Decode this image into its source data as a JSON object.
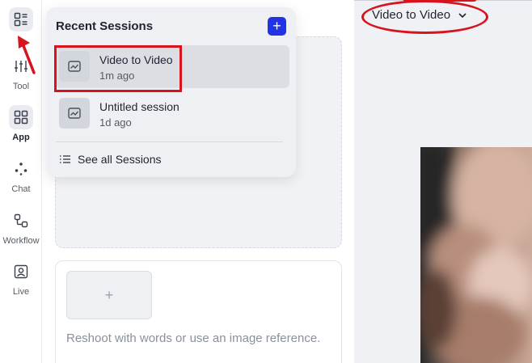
{
  "sidebar": {
    "items": [
      {
        "label": "",
        "icon": "sessions-list-icon"
      },
      {
        "label": "Tool",
        "icon": "sliders-icon"
      },
      {
        "label": "App",
        "icon": "grid-icon"
      },
      {
        "label": "Chat",
        "icon": "dots-icon"
      },
      {
        "label": "Workflow",
        "icon": "workflow-icon"
      },
      {
        "label": "Live",
        "icon": "person-frame-icon"
      }
    ]
  },
  "popover": {
    "title": "Recent Sessions",
    "add_label": "+",
    "sessions": [
      {
        "name": "Video to Video",
        "time": "1m ago",
        "selected": true
      },
      {
        "name": "Untitled session",
        "time": "1d ago",
        "selected": false
      }
    ],
    "see_all_label": "See all Sessions"
  },
  "main": {
    "add_reference_label": "+",
    "prompt_placeholder": "Reshoot with words or use an image reference."
  },
  "header": {
    "session_title": "Video to Video"
  },
  "colors": {
    "accent": "#2233e6",
    "annotation": "#d7141d",
    "panel_bg": "#f0f1f4"
  }
}
